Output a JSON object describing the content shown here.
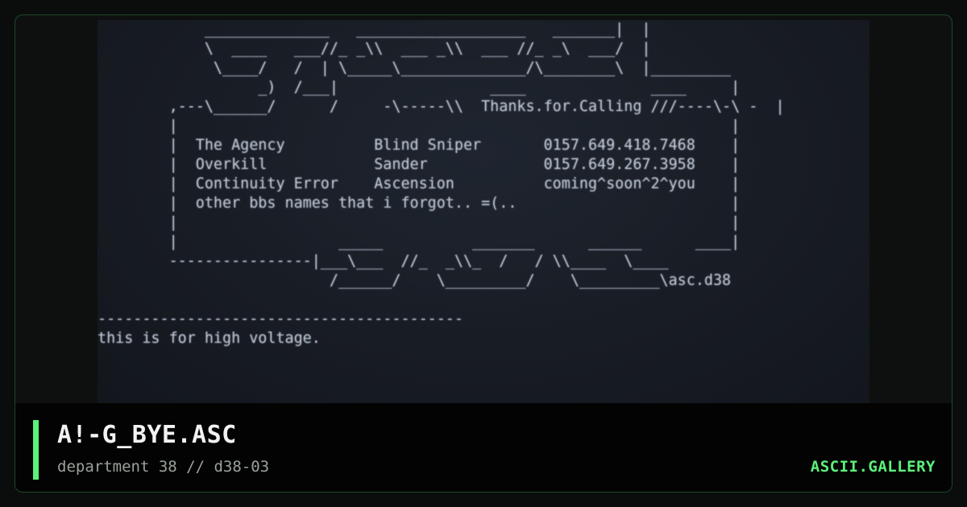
{
  "artwork": {
    "ascii_lines": [
      "            ______________   ___________________   _______|  |",
      "            \\  ____   ___//_ _\\\\  ___ _\\\\  ___ //_ _\\  ___/  |",
      "             \\____/   /  | \\_____\\______________/\\________\\  |_________",
      "                  _)  /___|                 ____              ____     |",
      "        ,---\\______/      /     -\\-----\\\\  Thanks.for.Calling ///----\\-\\ -  |",
      "        |                                                              |",
      "        |  The Agency          Blind Sniper       0157.649.418.7468    |",
      "        |  Overkill            Sander             0157.649.267.3958    |",
      "        |  Continuity Error    Ascension          coming^soon^2^you    |",
      "        |  other bbs names that i forgot.. =(..                        |",
      "        |                                                              |",
      "        |                  _____          _______      ______      ____|",
      "        ----------------|___\\___  //_  _\\\\_  /   / \\\\____  \\____",
      "                          /______/    \\_________/    \\_________\\asc.d38",
      "",
      "-----------------------------------------",
      "this is for high voltage."
    ]
  },
  "footer": {
    "title": "A!-G_BYE.ASC",
    "subtitle": "department 38 // d38-03",
    "brand": "ASCII.GALLERY"
  },
  "colors": {
    "accent": "#5cf07a",
    "ascii_text": "#bcc6d2",
    "screen_bg": "#181c24",
    "footer_bg": "#030303"
  }
}
